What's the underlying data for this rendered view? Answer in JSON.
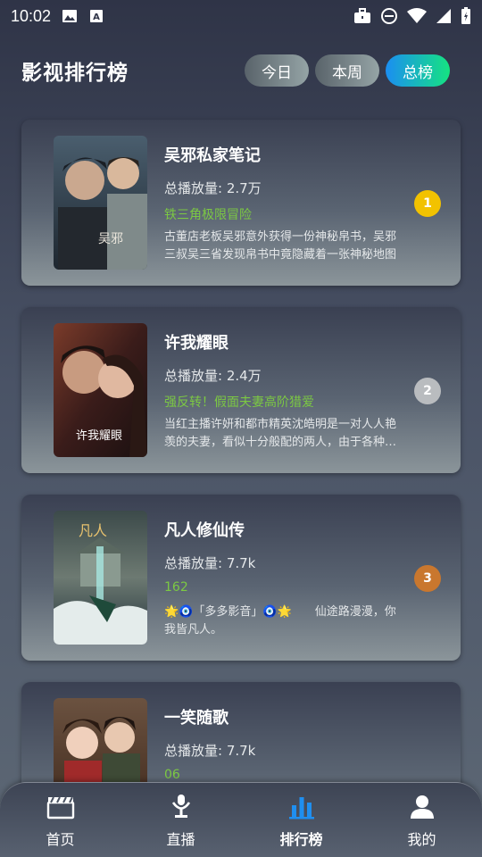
{
  "status_bar": {
    "time": "10:02"
  },
  "header": {
    "title": "影视排行榜",
    "tabs": [
      {
        "label": "今日",
        "active": false
      },
      {
        "label": "本周",
        "active": false
      },
      {
        "label": "总榜",
        "active": true
      }
    ]
  },
  "ranking": [
    {
      "title": "吴邪私家笔记",
      "plays": "总播放量: 2.7万",
      "tag": "铁三角极限冒险",
      "desc": "古董店老板吴邪意外获得一份神秘帛书，吴邪三叔吴三省发现帛书中竟隐藏着一张神秘地图",
      "rank": "1",
      "rank_color": "#f2c200",
      "poster_icon": "poster-image"
    },
    {
      "title": "许我耀眼",
      "plays": "总播放量: 2.4万",
      "tag": "强反转！假面夫妻高阶猎爱",
      "desc": "当红主播许妍和都市精英沈皓明是一对人人艳羡的夫妻，看似十分般配的两人，由于各种原因",
      "rank": "2",
      "rank_color": "#b9bcbf",
      "poster_icon": "poster-image"
    },
    {
      "title": "凡人修仙传",
      "plays": "总播放量: 7.7k",
      "tag": "162",
      "desc": "🌟🧿「多多影音」🧿🌟　　仙途路漫漫，你我皆凡人。",
      "rank": "3",
      "rank_color": "#c9772e",
      "poster_icon": "poster-image"
    },
    {
      "title": "一笑随歌",
      "plays": "总播放量: 7.7k",
      "tag": "06",
      "desc": "",
      "rank": "",
      "rank_color": "#c9772e",
      "poster_icon": "poster-image"
    }
  ],
  "bottom_nav": [
    {
      "label": "首页",
      "icon": "clapperboard-icon",
      "active": false
    },
    {
      "label": "直播",
      "icon": "live-tripod-icon",
      "active": false
    },
    {
      "label": "排行榜",
      "icon": "bar-chart-icon",
      "active": true
    },
    {
      "label": "我的",
      "icon": "user-icon",
      "active": false
    }
  ],
  "colors": {
    "accent_green": "#7cc943",
    "active_nav_icon": "#1f8ff0",
    "tab_active_start": "#1b8ef2",
    "tab_active_end": "#15e381"
  }
}
